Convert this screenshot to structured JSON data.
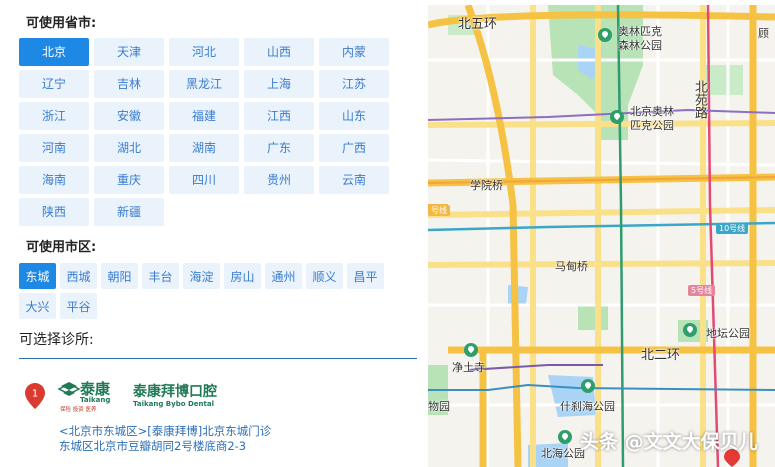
{
  "province_section": {
    "title": "可使用省市:",
    "selected": "北京",
    "items": [
      "北京",
      "天津",
      "河北",
      "山西",
      "内蒙",
      "辽宁",
      "吉林",
      "黑龙江",
      "上海",
      "江苏",
      "浙江",
      "安徽",
      "福建",
      "江西",
      "山东",
      "河南",
      "湖北",
      "湖南",
      "广东",
      "广西",
      "海南",
      "重庆",
      "四川",
      "贵州",
      "云南",
      "陕西",
      "新疆"
    ]
  },
  "district_section": {
    "title": "可使用市区:",
    "selected": "东城",
    "items": [
      "东城",
      "西城",
      "朝阳",
      "丰台",
      "海淀",
      "房山",
      "通州",
      "顺义",
      "昌平",
      "大兴",
      "平谷"
    ]
  },
  "clinic_section": {
    "title": "可选择诊所:",
    "clinics": [
      {
        "index": "1",
        "logo_cn": "泰康",
        "logo_en": "Taikang",
        "logo_slogan": "保险  投资  医养",
        "brand_cn": "泰康拜博口腔",
        "brand_en": "Taikang Bybo Dental",
        "link": "<北京市东城区>[泰康拜博]北京东城门诊",
        "address": "东城区北京市豆瓣胡同2号楼底商2-3"
      }
    ]
  },
  "map": {
    "labels": {
      "north_5th_ring": "北五环",
      "olympic_forest_1": "奥林匹克",
      "olympic_forest_2": "森林公园",
      "olympic_park_1": "北京奥林",
      "olympic_park_2": "匹克公园",
      "beiyuan_road": "北苑路",
      "xueyuan_bridge": "学院桥",
      "madian_bridge": "马甸桥",
      "ditan_park": "地坛公园",
      "north_2nd_ring": "北二环",
      "jingtu_temple": "净土寺",
      "shichahai_park": "什刹海公园",
      "beihai_park": "北海公园",
      "zoo": "物园",
      "edge_char": "顾"
    },
    "line_tags": {
      "line10": "10号线",
      "line5": "5号线",
      "line_left": "号线"
    },
    "colors": {
      "ring_road": "#f6c244",
      "main_road": "#fbe08a",
      "park": "#b7e3b6",
      "water": "#aad4f5",
      "line10": "#3aa7c9",
      "line5": "#e24a74",
      "line8": "#2f9b6e",
      "line13": "#f1b844",
      "lineX": "#8c6fc1"
    }
  },
  "watermark": "头条 @文文大保贝儿"
}
